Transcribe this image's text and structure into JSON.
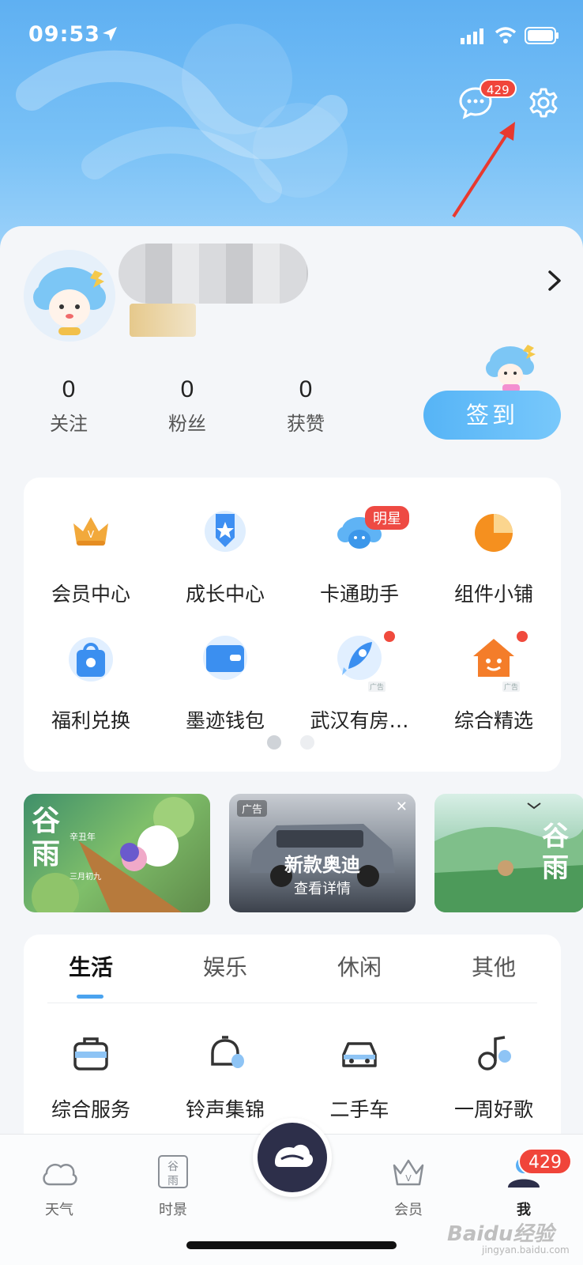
{
  "status_bar": {
    "time": "09:53"
  },
  "header": {
    "message_badge": "429"
  },
  "profile": {
    "stats": [
      {
        "value": "0",
        "label": "关注"
      },
      {
        "value": "0",
        "label": "粉丝"
      },
      {
        "value": "0",
        "label": "获赞"
      }
    ],
    "checkin_label": "签到"
  },
  "grid": {
    "items": [
      {
        "label": "会员中心",
        "icon": "crown-icon"
      },
      {
        "label": "成长中心",
        "icon": "medal-icon"
      },
      {
        "label": "卡通助手",
        "icon": "cloud-mascot-icon",
        "tag": "明星"
      },
      {
        "label": "组件小铺",
        "icon": "pie-icon"
      },
      {
        "label": "福利兑换",
        "icon": "shopping-bag-icon"
      },
      {
        "label": "墨迹钱包",
        "icon": "wallet-icon"
      },
      {
        "label": "武汉有房…",
        "icon": "rocket-icon",
        "ad": "广告"
      },
      {
        "label": "综合精选",
        "icon": "house-icon",
        "ad": "广告"
      }
    ],
    "page_indicator": {
      "pages": 2,
      "current": 1
    }
  },
  "banners": [
    {
      "title": "谷雨",
      "sub_small": "辛丑年",
      "date_small": "三月初九"
    },
    {
      "ad_tag": "广告",
      "headline": "新款奥迪",
      "sub": "查看详情"
    },
    {
      "title": "谷雨"
    }
  ],
  "services": {
    "tabs": [
      "生活",
      "娱乐",
      "休闲",
      "其他"
    ],
    "active_tab": "生活",
    "items": [
      {
        "label": "综合服务",
        "icon": "briefcase-icon"
      },
      {
        "label": "铃声集锦",
        "icon": "bell-icon"
      },
      {
        "label": "二手车",
        "icon": "car-icon"
      },
      {
        "label": "一周好歌",
        "icon": "music-note-icon"
      }
    ]
  },
  "tabbar": {
    "items": [
      {
        "label": "天气",
        "icon": "cloud-icon"
      },
      {
        "label": "时景",
        "icon": "guyu-icon",
        "icon_text": "谷雨"
      },
      {
        "label": "会员",
        "icon": "crown-outline-icon"
      },
      {
        "label": "我",
        "icon": "user-icon",
        "badge": "429"
      }
    ],
    "active": "我"
  },
  "watermark": {
    "main": "Baidu经验",
    "sub": "jingyan.baidu.com"
  },
  "colors": {
    "accent": "#4aa3ef",
    "badge": "#f0453a",
    "hero": "#6ab8f4"
  }
}
